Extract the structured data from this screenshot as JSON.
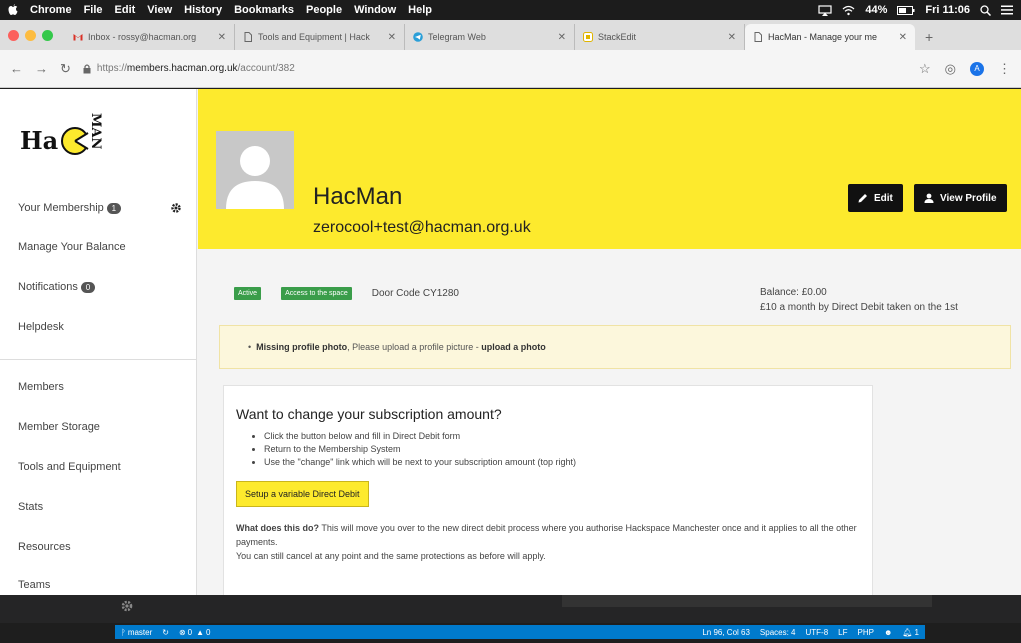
{
  "menubar": {
    "app": "Chrome",
    "items": [
      "File",
      "Edit",
      "View",
      "History",
      "Bookmarks",
      "People",
      "Window",
      "Help"
    ],
    "battery": "44%",
    "clock": "Fri 11:06"
  },
  "tabs": [
    {
      "title": "Inbox - rossy@hacman.org",
      "icon": "gmail-icon"
    },
    {
      "title": "Tools and Equipment | Hack",
      "icon": "page-icon"
    },
    {
      "title": "Telegram Web",
      "icon": "telegram-icon"
    },
    {
      "title": "StackEdit",
      "icon": "stackedit-icon"
    },
    {
      "title": "HacMan - Manage your me",
      "icon": "page-icon"
    }
  ],
  "address": {
    "scheme": "https://",
    "host": "members.hacman.org.uk",
    "path": "/account/382",
    "profile_initial": "A"
  },
  "logo": {
    "text": "Ha",
    "letters": "MAN"
  },
  "sidebar": {
    "items": [
      {
        "label": "Your Membership",
        "badge": "1"
      },
      {
        "label": "Manage Your Balance",
        "badge": ""
      },
      {
        "label": "Notifications",
        "badge": "0"
      },
      {
        "label": "Helpdesk",
        "badge": ""
      },
      {
        "label": "Members",
        "badge": ""
      },
      {
        "label": "Member Storage",
        "badge": ""
      },
      {
        "label": "Tools and Equipment",
        "badge": ""
      },
      {
        "label": "Stats",
        "badge": ""
      },
      {
        "label": "Resources",
        "badge": ""
      },
      {
        "label": "Teams",
        "badge": ""
      }
    ]
  },
  "profile": {
    "name": "HacMan",
    "email": "zerocool+test@hacman.org.uk",
    "edit_label": "Edit",
    "view_label": "View Profile"
  },
  "status": {
    "active": "Active",
    "access": "Access to the space",
    "door_code": "Door Code CY1280",
    "balance": "Balance: £0.00",
    "subscription": "£10 a month by Direct Debit taken on the 1st"
  },
  "alert": {
    "bold": "Missing profile photo",
    "text": ", Please upload a profile picture - ",
    "link": "upload a photo"
  },
  "card": {
    "title": "Want to change your subscription amount?",
    "steps": [
      "Click the button below and fill in Direct Debit form",
      "Return to the Membership System",
      "Use the \"change\" link which will be next to your subscription amount (top right)"
    ],
    "button": "Setup a variable Direct Debit",
    "what_bold": "What does this do?",
    "what_text": " This will move you over to the new direct debit process where you authorise Hackspace Manchester once and it applies to all the other payments.",
    "cancel_text": "You can still cancel at any point and the same protections as before will apply."
  },
  "editor_status": {
    "branch": "master",
    "errors": "0",
    "warnings": "0",
    "position": "Ln 96, Col 63",
    "spaces": "Spaces: 4",
    "encoding": "UTF-8",
    "eol": "LF",
    "language": "PHP",
    "notifications": "1"
  }
}
